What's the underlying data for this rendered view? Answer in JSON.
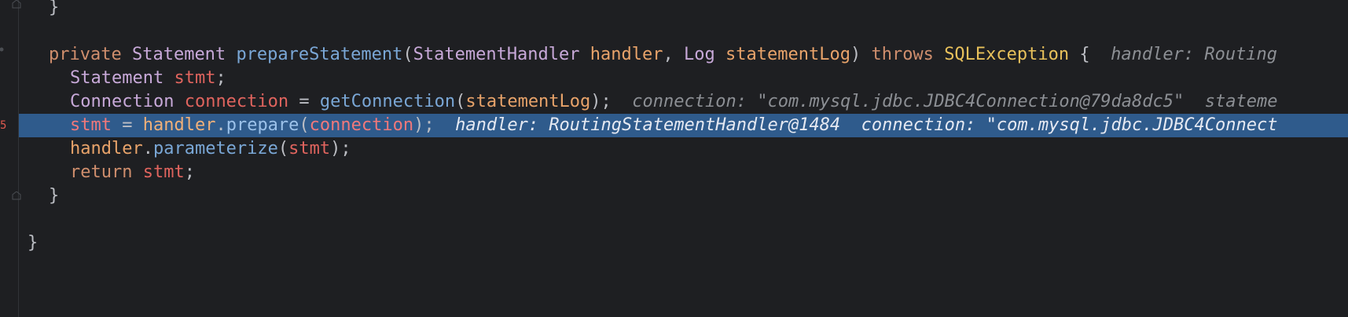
{
  "editor": {
    "lines": [
      {
        "id": "close-brace-1",
        "segments": [
          {
            "cls": "plain",
            "text": "}"
          }
        ]
      },
      {
        "id": "method-signature",
        "segments": [
          {
            "cls": "kw",
            "text": "private"
          },
          {
            "cls": "plain",
            "text": " "
          },
          {
            "cls": "type",
            "text": "Statement"
          },
          {
            "cls": "plain",
            "text": " "
          },
          {
            "cls": "fn",
            "text": "prepareStatement"
          },
          {
            "cls": "plain",
            "text": "("
          },
          {
            "cls": "type",
            "text": "StatementHandler"
          },
          {
            "cls": "plain",
            "text": " "
          },
          {
            "cls": "param",
            "text": "handler"
          },
          {
            "cls": "plain",
            "text": ", "
          },
          {
            "cls": "type",
            "text": "Log"
          },
          {
            "cls": "plain",
            "text": " "
          },
          {
            "cls": "param",
            "text": "statementLog"
          },
          {
            "cls": "plain",
            "text": ") "
          },
          {
            "cls": "kw",
            "text": "throws"
          },
          {
            "cls": "plain",
            "text": " "
          },
          {
            "cls": "exc",
            "text": "SQLException"
          },
          {
            "cls": "plain",
            "text": " {  "
          },
          {
            "cls": "inlay",
            "text": "handler: Routing"
          }
        ]
      },
      {
        "id": "stmt-decl",
        "segments": [
          {
            "cls": "type",
            "text": "Statement"
          },
          {
            "cls": "plain",
            "text": " "
          },
          {
            "cls": "lv",
            "text": "stmt"
          },
          {
            "cls": "plain",
            "text": ";"
          }
        ]
      },
      {
        "id": "connection-decl",
        "segments": [
          {
            "cls": "type",
            "text": "Connection"
          },
          {
            "cls": "plain",
            "text": " "
          },
          {
            "cls": "lv",
            "text": "connection"
          },
          {
            "cls": "plain",
            "text": " = "
          },
          {
            "cls": "fn",
            "text": "getConnection"
          },
          {
            "cls": "plain",
            "text": "("
          },
          {
            "cls": "param",
            "text": "statementLog"
          },
          {
            "cls": "plain",
            "text": ");  "
          },
          {
            "cls": "inlay",
            "text": "connection: \"com.mysql.jdbc.JDBC4Connection@79da8dc5\"  stateme"
          }
        ]
      },
      {
        "id": "current-line",
        "segments": [
          {
            "cls": "lv",
            "text": "stmt"
          },
          {
            "cls": "plain",
            "text": " = "
          },
          {
            "cls": "param",
            "text": "handler"
          },
          {
            "cls": "plain",
            "text": "."
          },
          {
            "cls": "fn",
            "text": "prepare"
          },
          {
            "cls": "plain",
            "text": "("
          },
          {
            "cls": "lv",
            "text": "connection"
          },
          {
            "cls": "plain",
            "text": ");  "
          },
          {
            "cls": "inlay",
            "text": "handler: RoutingStatementHandler@1484  connection: \"com.mysql.jdbc.JDBC4Connect"
          }
        ]
      },
      {
        "id": "parameterize-call",
        "segments": [
          {
            "cls": "param",
            "text": "handler"
          },
          {
            "cls": "plain",
            "text": "."
          },
          {
            "cls": "fn",
            "text": "parameterize"
          },
          {
            "cls": "plain",
            "text": "("
          },
          {
            "cls": "lv",
            "text": "stmt"
          },
          {
            "cls": "plain",
            "text": ");"
          }
        ]
      },
      {
        "id": "return-stmt",
        "segments": [
          {
            "cls": "kw",
            "text": "return"
          },
          {
            "cls": "plain",
            "text": " "
          },
          {
            "cls": "lv",
            "text": "stmt"
          },
          {
            "cls": "plain",
            "text": ";"
          }
        ]
      },
      {
        "id": "close-brace-2",
        "segments": [
          {
            "cls": "plain",
            "text": "}"
          }
        ]
      },
      {
        "id": "class-close-brace",
        "segments": [
          {
            "cls": "plain",
            "text": "}"
          }
        ]
      }
    ],
    "gutter_marker": "5",
    "colors": {
      "background": "#1e1f22",
      "execution_line": "#2f5b8c",
      "keyword": "#cf8e6d",
      "type": "#c8a9d9",
      "method": "#7aa7d6",
      "parameter": "#e8a36a",
      "local_variable": "#e0645e",
      "exception": "#e8c15b",
      "inlay_hint": "#8c8f94"
    }
  }
}
